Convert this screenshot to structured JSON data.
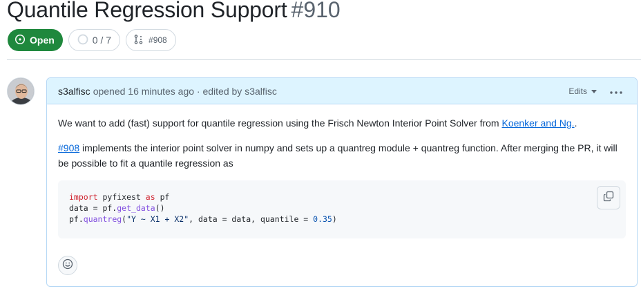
{
  "issue": {
    "title": "Quantile Regression Support",
    "number": "#910",
    "state": "Open",
    "subissues": "0 / 7",
    "linked_pr": "#908"
  },
  "comment": {
    "author": "s3alfisc",
    "meta_opened": "opened 16 minutes ago · edited by",
    "editor": "s3alfisc",
    "edits_label": "Edits",
    "para1_text": "We want to add (fast) support for quantile regression using the Frisch Newton Interior Point Solver from",
    "para1_link": "Koenker and Ng.",
    "para1_end": ".",
    "para2_link": "#908",
    "para2_text": "implements the interior point solver in numpy and sets up a quantreg module + quantreg function. After merging the PR, it will be possible to fit a quantile regression as",
    "code": {
      "line1_kw1": "import",
      "line1_mid": " pyfixest ",
      "line1_kw2": "as",
      "line1_end": " pf",
      "line2_start": "data = pf.",
      "line2_fn": "get_data",
      "line2_end": "()",
      "line3_start": "pf.",
      "line3_fn": "quantreg",
      "line3_open": "(",
      "line3_str": "\"Y ~ X1 + X2\"",
      "line3_mid": ", data = data, quantile = ",
      "line3_num": "0.35",
      "line3_close": ")"
    }
  },
  "colors": {
    "open_green": "#1f883d",
    "link_blue": "#0969da",
    "header_bg": "#ddf4ff"
  }
}
